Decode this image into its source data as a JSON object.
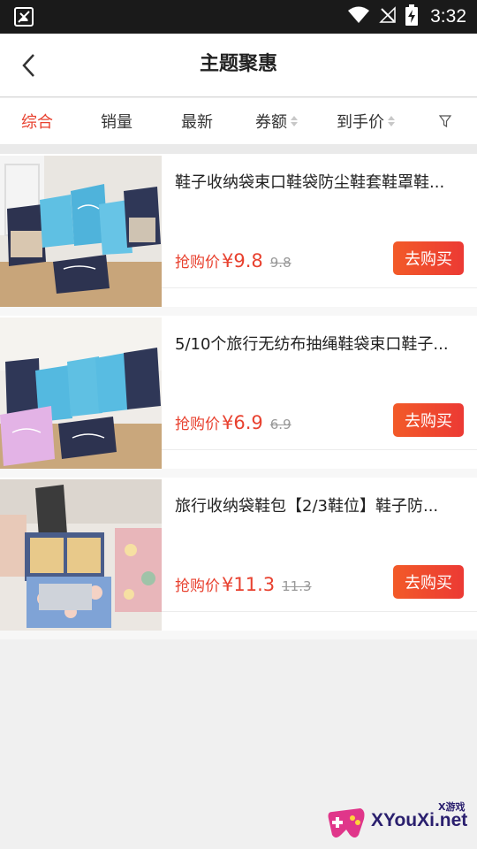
{
  "status_bar": {
    "time": "3:32",
    "icons": [
      "app-icon",
      "wifi-icon",
      "no-signal-icon",
      "battery-charging-icon"
    ]
  },
  "nav": {
    "title": "主题聚惠",
    "back_icon": "chevron-left-icon"
  },
  "sort_tabs": [
    {
      "label": "综合",
      "active": true
    },
    {
      "label": "销量",
      "active": false
    },
    {
      "label": "最新",
      "active": false
    },
    {
      "label": "券额",
      "active": false,
      "sortable": true
    },
    {
      "label": "到手价",
      "active": false,
      "sortable": true
    },
    {
      "icon": "filter-icon"
    }
  ],
  "products": [
    {
      "title": "鞋子收纳袋束口鞋袋防尘鞋套鞋罩鞋...",
      "price_label": "抢购价",
      "price_now": "¥9.8",
      "price_old": "9.8",
      "buy_label": "去购买"
    },
    {
      "title": "5/10个旅行无纺布抽绳鞋袋束口鞋子...",
      "price_label": "抢购价",
      "price_now": "¥6.9",
      "price_old": "6.9",
      "buy_label": "去购买"
    },
    {
      "title": "旅行收纳袋鞋包【2/3鞋位】鞋子防...",
      "price_label": "抢购价",
      "price_now": "¥11.3",
      "price_old": "11.3",
      "buy_label": "去购买"
    }
  ],
  "watermark": {
    "text": "XYouXi.net",
    "small": "X游戏"
  },
  "colors": {
    "accent": "#e8412f",
    "button": "#f04a2e",
    "status_bar": "#1a1a1a"
  }
}
